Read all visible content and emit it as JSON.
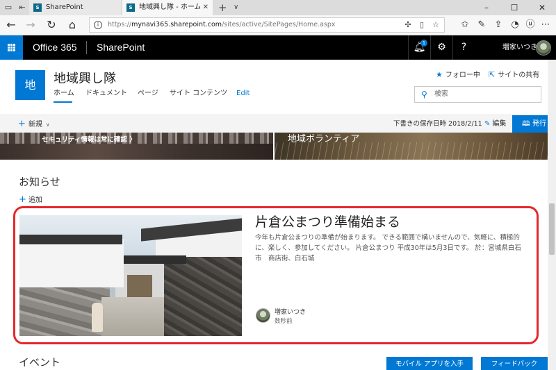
{
  "browser": {
    "tabs": [
      {
        "label": "SharePoint",
        "favicon": "S",
        "active": false
      },
      {
        "label": "地域興し隊 - ホーム",
        "favicon": "S",
        "active": true
      }
    ],
    "new_tab_icon": "+",
    "tab_menu_icon": "chevron-down-icon",
    "window_controls": {
      "minimize": "–",
      "maximize": "☐",
      "close": "✕"
    },
    "url_host": "mynavi365.sharepoint.com",
    "url_prefix": "https://",
    "url_path": "/sites/active/SitePages/Home.aspx"
  },
  "suite_bar": {
    "waffle_icon": "app-launcher-icon",
    "product": "Office 365",
    "app": "SharePoint",
    "notification_count": "1",
    "user_name": "増家いつき",
    "accent_color": "#0078d4"
  },
  "site": {
    "logo_letter": "地",
    "title": "地域興し隊",
    "nav": [
      "ホーム",
      "ドキュメント",
      "ページ",
      "サイト コンテンツ",
      "Edit"
    ],
    "follow_label": "フォロー中",
    "share_label": "サイトの共有",
    "search_placeholder": "検索"
  },
  "command_bar": {
    "new_label": "新規",
    "saved_text": "下書きの保存日時 2018/2/11",
    "edit_label": "編集",
    "publish_label": "発行"
  },
  "hero": {
    "left_caption": "セキュリティ情報は常に確認 〉",
    "right_caption": "地域ボランティア"
  },
  "news": {
    "heading": "お知らせ",
    "add_label": "追加",
    "highlight_color": "#e5282b",
    "item": {
      "title": "片倉公まつり準備始まる",
      "body": "今年も片倉公まつりの準備が始まります。 できる範囲で構いませんので、気軽に、積極的に、楽しく、参加してください。 片倉公まつり 平成30年は5月3日です。 於：宮城県白石市　商店街、白石城",
      "author": "増家いつき",
      "time": "数秒前"
    }
  },
  "events": {
    "heading": "イベント"
  },
  "footer_buttons": {
    "mobile_app": "モバイル アプリを入手",
    "feedback": "フィードバック"
  }
}
